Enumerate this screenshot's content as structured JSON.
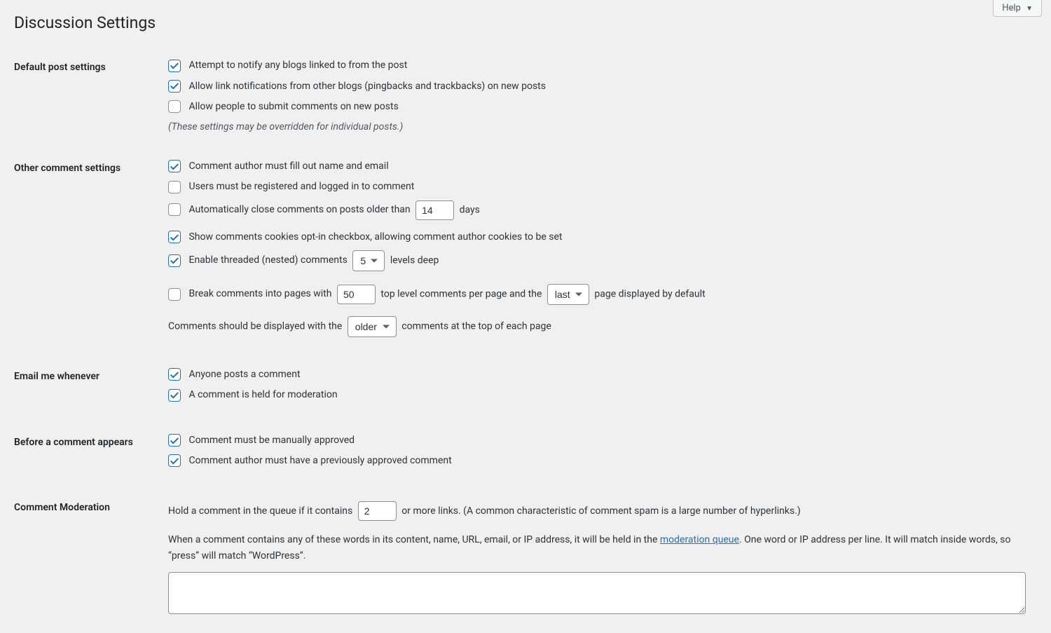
{
  "help": {
    "label": "Help"
  },
  "page_title": "Discussion Settings",
  "sections": {
    "default_post": {
      "heading": "Default post settings",
      "notify_blogs": {
        "label": "Attempt to notify any blogs linked to from the post",
        "checked": true
      },
      "allow_pings": {
        "label": "Allow link notifications from other blogs (pingbacks and trackbacks) on new posts",
        "checked": true
      },
      "allow_comments": {
        "label": "Allow people to submit comments on new posts",
        "checked": false
      },
      "note": "(These settings may be overridden for individual posts.)"
    },
    "other_comment": {
      "heading": "Other comment settings",
      "require_name_email": {
        "label": "Comment author must fill out name and email",
        "checked": true
      },
      "require_registration": {
        "label": "Users must be registered and logged in to comment",
        "checked": false
      },
      "close_comments": {
        "checked": false,
        "prefix": "Automatically close comments on posts older than",
        "days_value": "14",
        "suffix": "days"
      },
      "cookies_optin": {
        "label": "Show comments cookies opt-in checkbox, allowing comment author cookies to be set",
        "checked": true
      },
      "threaded": {
        "checked": true,
        "prefix": "Enable threaded (nested) comments",
        "levels_value": "5",
        "suffix": "levels deep"
      },
      "pagination": {
        "checked": false,
        "prefix": "Break comments into pages with",
        "per_page_value": "50",
        "mid": "top level comments per page and the",
        "default_page_value": "last",
        "suffix": "page displayed by default"
      },
      "order": {
        "prefix": "Comments should be displayed with the",
        "value": "older",
        "suffix": "comments at the top of each page"
      }
    },
    "email_me": {
      "heading": "Email me whenever",
      "anyone_posts": {
        "label": "Anyone posts a comment",
        "checked": true
      },
      "held_moderation": {
        "label": "A comment is held for moderation",
        "checked": true
      }
    },
    "before_appears": {
      "heading": "Before a comment appears",
      "manual_approve": {
        "label": "Comment must be manually approved",
        "checked": true
      },
      "prev_approved": {
        "label": "Comment author must have a previously approved comment",
        "checked": true
      }
    },
    "moderation": {
      "heading": "Comment Moderation",
      "links": {
        "prefix": "Hold a comment in the queue if it contains",
        "value": "2",
        "suffix": "or more links. (A common characteristic of comment spam is a large number of hyperlinks.)"
      },
      "help_pre": "When a comment contains any of these words in its content, name, URL, email, or IP address, it will be held in the ",
      "help_link": "moderation queue",
      "help_post": ". One word or IP address per line. It will match inside words, so “press” will match “WordPress”."
    }
  }
}
